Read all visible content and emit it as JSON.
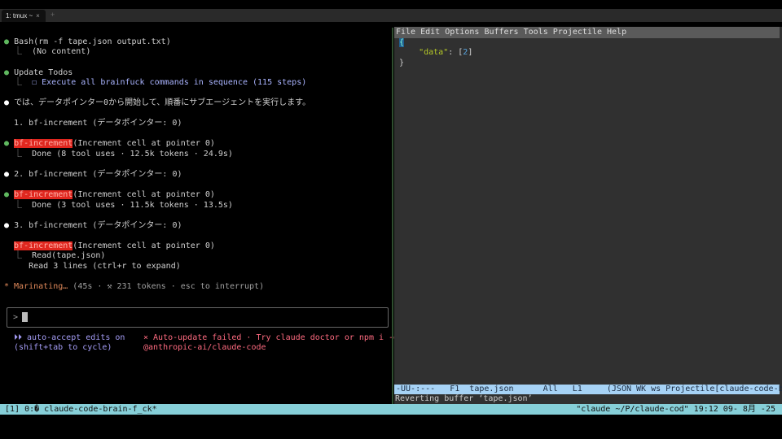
{
  "tab": {
    "title": "1: tmux ~",
    "close": "×",
    "new": "+"
  },
  "claude": {
    "bash_call": "Bash(rm -f tape.json output.txt)",
    "bash_result": "(No content)",
    "todos_title": "Update Todos",
    "todo_item": "☐ Execute all brainfuck commands in sequence (115 steps)",
    "intro": "では、データポインター0から開始して、順番にサブエージェントを実行します。",
    "step1": "1. bf-increment (データポインター: 0)",
    "step2": "2. bf-increment (データポインター: 0)",
    "step3": "3. bf-increment (データポインター: 0)",
    "agent_name": "bf-increment",
    "agent_args": "(Increment cell at pointer 0)",
    "done1": "Done (8 tool uses · 12.5k tokens · 24.9s)",
    "done2": "Done (3 tool uses · 11.5k tokens · 13.5s)",
    "read_call": "Read(tape.json)",
    "read_result": "Read 3 lines (ctrl+r to expand)",
    "status_word": "* Marinating…",
    "status_detail": " (45s · ⚒ 231 tokens · esc to interrupt)",
    "prompt": ">",
    "auto_accept": "⏵⏵ auto-accept edits on",
    "cycle_hint": "(shift+tab to cycle)",
    "update_error": "× Auto-update failed · Try claude doctor or npm i -g",
    "update_pkg": "@anthropic-ai/claude-code"
  },
  "emacs": {
    "menu": [
      "File",
      "Edit",
      "Options",
      "Buffers",
      "Tools",
      "Projectile",
      "Help"
    ],
    "code_open": "{",
    "code_key": "\"data\"",
    "code_colon": ": [",
    "code_value": "2",
    "code_close_bracket": "]",
    "code_close": "}",
    "modeline": "-UU-:---   F1  tape.json      All   L1     (JSON WK ws Projectile[claude-code-brain-f_",
    "echo": "Reverting buffer ‘tape.json’"
  },
  "tmux": {
    "left": "[1] 0:� claude-code-brain-f_ck*",
    "right": "\"claude ~/P/claude-cod\" 19:12 09- 8月 -25"
  }
}
